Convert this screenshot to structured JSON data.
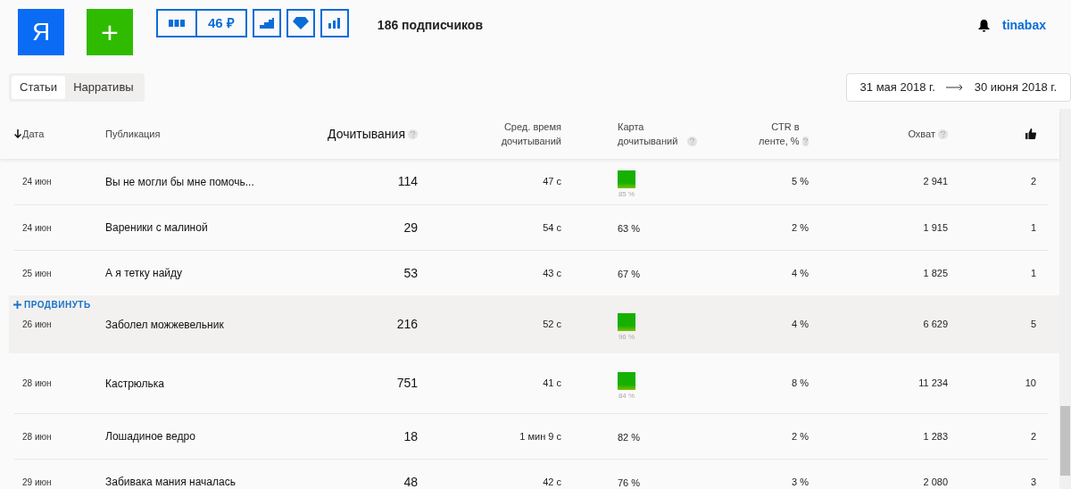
{
  "header": {
    "logo": "Я",
    "add_button": "+",
    "toolbar": [
      {
        "kind": "icon"
      },
      {
        "kind": "text",
        "label": "46 ₽"
      },
      {
        "kind": "icon"
      },
      {
        "kind": "icon"
      },
      {
        "kind": "icon"
      }
    ],
    "subscribers": "186 подписчиков",
    "user": "tinabax"
  },
  "tabs": [
    {
      "label": "Статьи",
      "selected": true
    },
    {
      "label": "Нарративы",
      "selected": false
    }
  ],
  "date_range": {
    "from": "31 мая 2018 г.",
    "to": "30 июня 2018 г."
  },
  "table": {
    "columns": [
      {
        "label": "Дата",
        "sorted": true
      },
      {
        "label": "Публикация"
      },
      {
        "label": "Дочитывания",
        "help": true
      },
      {
        "label": "Сред. время дочитываний"
      },
      {
        "label": "Карта дочитываний",
        "help": true
      },
      {
        "label": "CTR в ленте, %",
        "help": true
      },
      {
        "label": "Охват",
        "help": true
      }
    ],
    "rows": [
      {
        "date": "24 июн",
        "title": "Вы не могли бы мне помочь...",
        "reads": "114",
        "avg_time": "47 с",
        "map": {
          "kind": "square",
          "value": "85 %"
        },
        "ctr": "5 %",
        "reach": "2 941",
        "likes": "2",
        "hovered": false
      },
      {
        "date": "24 июн",
        "title": "Вареники с малиной",
        "reads": "29",
        "avg_time": "54 с",
        "map": {
          "kind": "text",
          "value": "63 %"
        },
        "ctr": "2 %",
        "reach": "1 915",
        "likes": "1",
        "hovered": false
      },
      {
        "date": "25 июн",
        "title": "А я тетку найду",
        "reads": "53",
        "avg_time": "43 с",
        "map": {
          "kind": "text",
          "value": "67 %"
        },
        "ctr": "4 %",
        "reach": "1 825",
        "likes": "1",
        "hovered": false
      },
      {
        "date": "26 июн",
        "title": "Заболел можжевельник",
        "reads": "216",
        "avg_time": "52 с",
        "map": {
          "kind": "square",
          "value": "96 %"
        },
        "ctr": "4 %",
        "reach": "6 629",
        "likes": "5",
        "hovered": true,
        "promote": "ПРОДВИНУТЬ"
      },
      {
        "date": "28 июн",
        "title": "Кастрюлька",
        "reads": "751",
        "avg_time": "41 с",
        "map": {
          "kind": "square",
          "value": "84 %"
        },
        "ctr": "8 %",
        "reach": "11 234",
        "likes": "10",
        "hovered": false
      },
      {
        "date": "28 июн",
        "title": "Лошадиное ведро",
        "reads": "18",
        "avg_time": "1 мин 9 с",
        "map": {
          "kind": "text",
          "value": "82 %"
        },
        "ctr": "2 %",
        "reach": "1 283",
        "likes": "2",
        "hovered": false
      },
      {
        "date": "29 июн",
        "title": "Забивака мания началась",
        "reads": "48",
        "avg_time": "42 с",
        "map": {
          "kind": "text",
          "value": "76 %"
        },
        "ctr": "3 %",
        "reach": "2 080",
        "likes": "3",
        "hovered": false
      }
    ]
  }
}
